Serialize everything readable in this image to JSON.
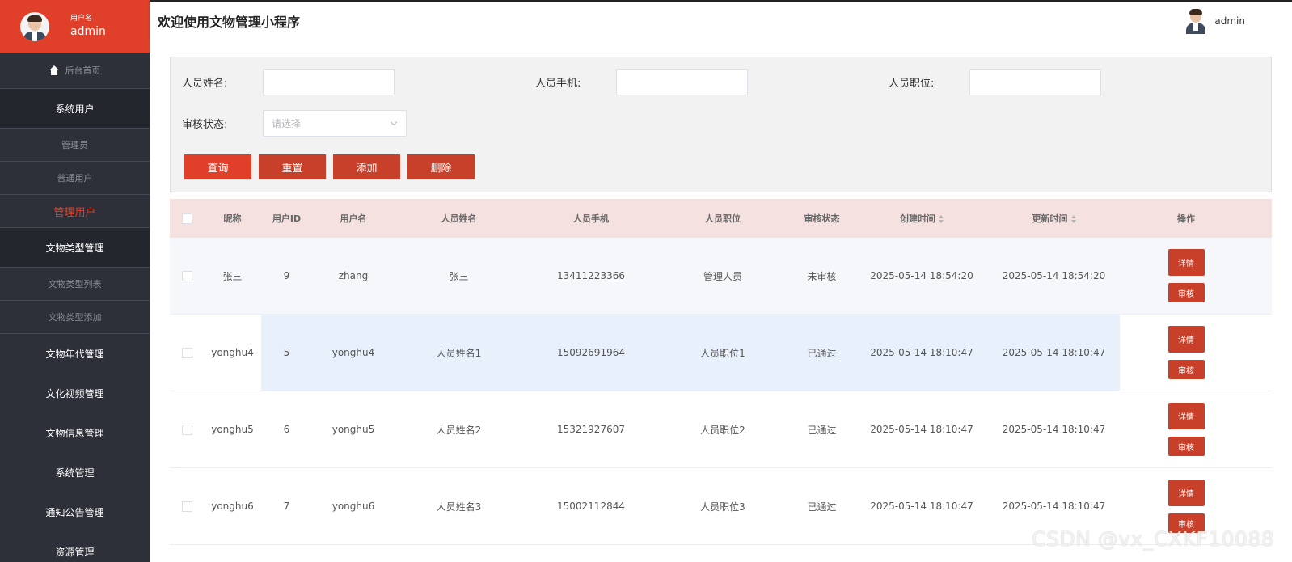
{
  "sidebar": {
    "user_label": "用户名",
    "user_name": "admin",
    "menu": [
      {
        "label": "后台首页",
        "kind": "home"
      },
      {
        "label": "系统用户",
        "kind": "group"
      },
      {
        "label": "管理员",
        "kind": "sub"
      },
      {
        "label": "普通用户",
        "kind": "sub"
      },
      {
        "label": "管理用户",
        "kind": "active"
      },
      {
        "label": "文物类型管理",
        "kind": "group"
      },
      {
        "label": "文物类型列表",
        "kind": "sub"
      },
      {
        "label": "文物类型添加",
        "kind": "sub"
      },
      {
        "label": "文物年代管理",
        "kind": "main"
      },
      {
        "label": "文化视频管理",
        "kind": "main"
      },
      {
        "label": "文物信息管理",
        "kind": "main"
      },
      {
        "label": "系统管理",
        "kind": "main"
      },
      {
        "label": "通知公告管理",
        "kind": "main"
      },
      {
        "label": "资源管理",
        "kind": "main"
      }
    ]
  },
  "topbar": {
    "title": "欢迎使用文物管理小程序",
    "user_name": "admin"
  },
  "search": {
    "name_label": "人员姓名:",
    "phone_label": "人员手机:",
    "position_label": "人员职位:",
    "status_label": "审核状态:",
    "status_placeholder": "请选择",
    "query_button": "查询",
    "reset_button": "重置",
    "add_button": "添加",
    "delete_button": "删除"
  },
  "table": {
    "headers": [
      "昵称",
      "用户ID",
      "用户名",
      "人员姓名",
      "人员手机",
      "人员职位",
      "审核状态",
      "创建时间",
      "更新时间",
      "操作"
    ],
    "detail_label": "详情",
    "audit_label": "审核",
    "rows": [
      {
        "nickname": "张三",
        "id": "9",
        "username": "zhang",
        "name": "张三",
        "phone": "13411223366",
        "position": "管理人员",
        "status": "未审核",
        "created": "2025-05-14 18:54:20",
        "updated": "2025-05-14 18:54:20"
      },
      {
        "nickname": "yonghu4",
        "id": "5",
        "username": "yonghu4",
        "name": "人员姓名1",
        "phone": "15092691964",
        "position": "人员职位1",
        "status": "已通过",
        "created": "2025-05-14 18:10:47",
        "updated": "2025-05-14 18:10:47"
      },
      {
        "nickname": "yonghu5",
        "id": "6",
        "username": "yonghu5",
        "name": "人员姓名2",
        "phone": "15321927607",
        "position": "人员职位2",
        "status": "已通过",
        "created": "2025-05-14 18:10:47",
        "updated": "2025-05-14 18:10:47"
      },
      {
        "nickname": "yonghu6",
        "id": "7",
        "username": "yonghu6",
        "name": "人员姓名3",
        "phone": "15002112844",
        "position": "人员职位3",
        "status": "已通过",
        "created": "2025-05-14 18:10:47",
        "updated": "2025-05-14 18:10:47"
      }
    ]
  },
  "watermark": "CSDN @vx_CXKF10088"
}
